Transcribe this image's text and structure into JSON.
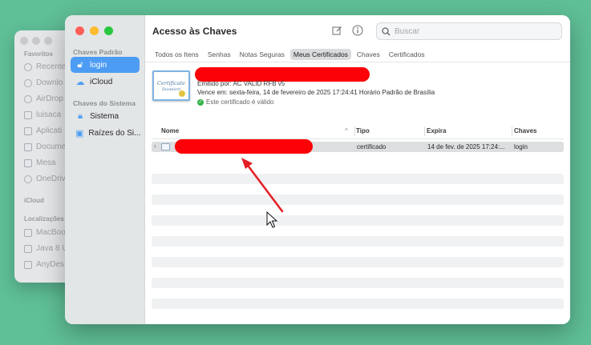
{
  "finder": {
    "favorites_header": "Favoritos",
    "items": [
      {
        "label": "Recente",
        "icon": "clock-icon"
      },
      {
        "label": "Downlo",
        "icon": "download-icon"
      },
      {
        "label": "AirDrop",
        "icon": "airdrop-icon"
      },
      {
        "label": "luisaca",
        "icon": "home-icon"
      },
      {
        "label": "Aplicati",
        "icon": "applications-icon"
      },
      {
        "label": "Docume",
        "icon": "document-icon"
      },
      {
        "label": "Mesa",
        "icon": "desktop-icon"
      },
      {
        "label": "OneDriv",
        "icon": "cloud-icon"
      }
    ],
    "icloud_header": "iCloud",
    "locations_header": "Localizações",
    "locations": [
      {
        "label": "MacBoo",
        "icon": "laptop-icon"
      },
      {
        "label": "Java 8 U",
        "icon": "disk-icon"
      },
      {
        "label": "AnyDes",
        "icon": "disk-icon"
      }
    ]
  },
  "sidebar": {
    "section1": "Chaves Padrão",
    "items1": [
      {
        "label": "login",
        "icon": "lock-icon",
        "active": true
      },
      {
        "label": "iCloud",
        "icon": "cloud-icon",
        "active": false
      }
    ],
    "section2": "Chaves do Sistema",
    "items2": [
      {
        "label": "Sistema",
        "icon": "lock-icon",
        "active": false
      },
      {
        "label": "Raízes do Si...",
        "icon": "cabinet-icon",
        "active": false
      }
    ]
  },
  "header": {
    "title": "Acesso às Chaves",
    "search_placeholder": "Buscar"
  },
  "tabs": [
    {
      "label": "Todos os Itens",
      "active": false
    },
    {
      "label": "Senhas",
      "active": false
    },
    {
      "label": "Notas Seguras",
      "active": false
    },
    {
      "label": "Meus Certificados",
      "active": true
    },
    {
      "label": "Chaves",
      "active": false
    },
    {
      "label": "Certificados",
      "active": false
    }
  ],
  "certificate": {
    "icon_line1": "Certificate",
    "icon_line2": "Standard",
    "issuer": "Emitido por: AC VALID RFB v5",
    "expires": "Vence em: sexta-feira, 14 de fevereiro de 2025 17:24:41 Horário Padrão de Brasília",
    "status": "Este certificado é válido"
  },
  "table": {
    "columns": [
      "Nome",
      "Tipo",
      "Expira",
      "Chaves"
    ],
    "rows": [
      {
        "name": "",
        "type": "certificado",
        "expires": "14 de fev. de 2025 17:24:...",
        "keychain": "login"
      }
    ]
  },
  "colors": {
    "background": "#5fbf97",
    "accent": "#4d9cf3",
    "redaction": "#fc0107",
    "annotation_arrow": "#e31e25"
  }
}
